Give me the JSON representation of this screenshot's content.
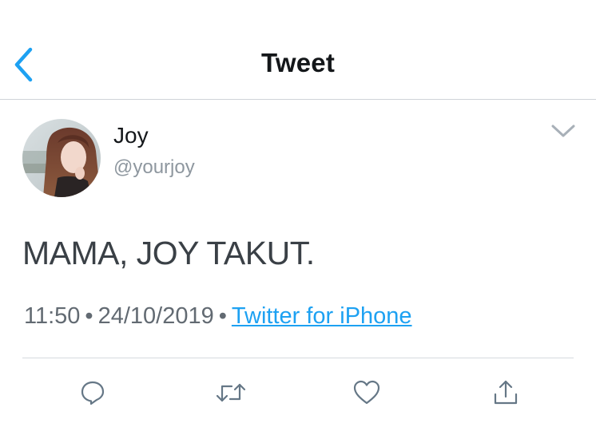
{
  "header": {
    "title": "Tweet",
    "back_icon": "chevron-left-icon",
    "accent_color": "#1da1f2"
  },
  "tweet": {
    "author": {
      "name": "Joy",
      "handle": "@yourjoy"
    },
    "text": "MAMA, JOY TAKUT.",
    "time": "11:50",
    "separator": "•",
    "date": "24/10/2019",
    "source": "Twitter for iPhone"
  },
  "actions": [
    {
      "name": "reply",
      "icon": "comment-icon"
    },
    {
      "name": "retweet",
      "icon": "retweet-icon"
    },
    {
      "name": "like",
      "icon": "heart-icon"
    },
    {
      "name": "share",
      "icon": "share-icon"
    }
  ],
  "colors": {
    "text": "#14171a",
    "secondary": "#8e979f",
    "link": "#1da1f2",
    "icon": "#657786"
  }
}
